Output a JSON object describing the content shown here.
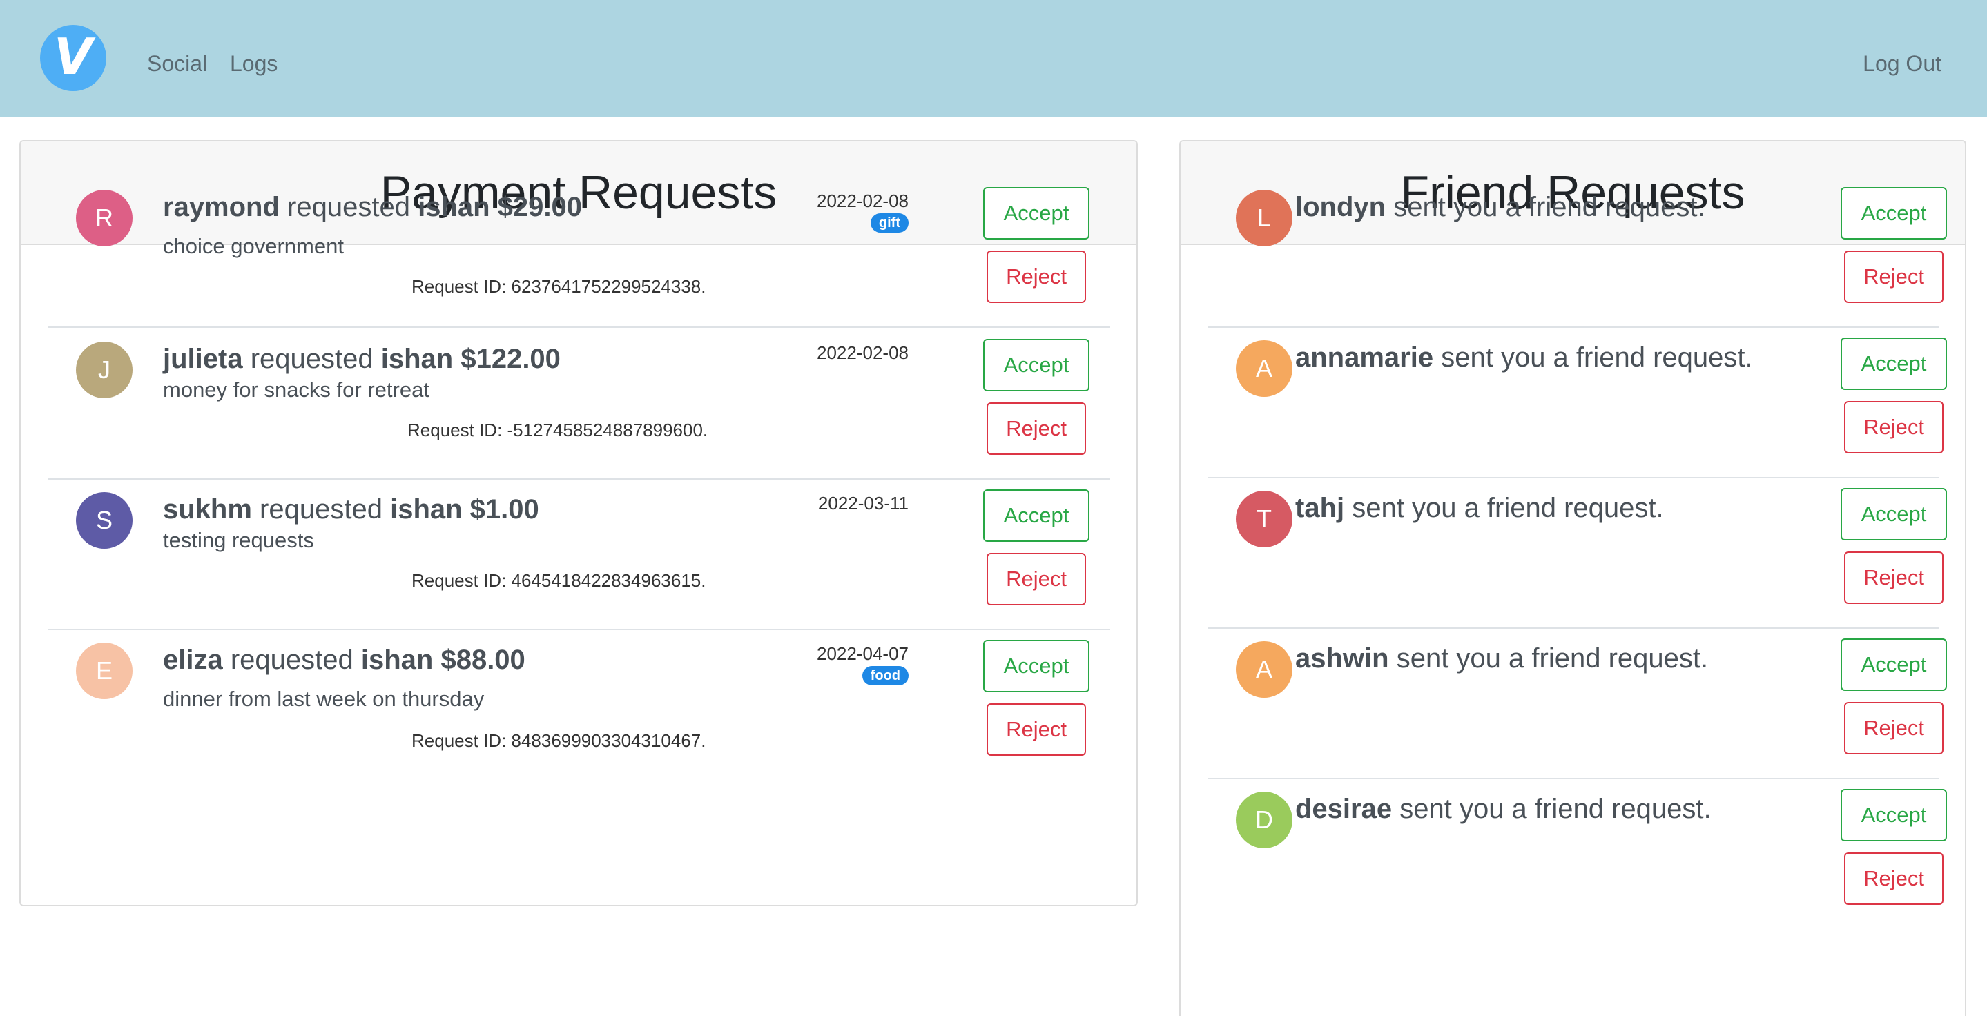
{
  "colors": {
    "navbar_bg": "#add5e1",
    "logo_bg": "#4eaef5",
    "accept": "#28a745",
    "reject": "#dc3545",
    "tag_bg": "#1e88e5"
  },
  "nav": {
    "logo_letter": "V",
    "links": [
      "Social",
      "Logs"
    ],
    "logout": "Log Out"
  },
  "payments": {
    "title": "Payment Requests",
    "items": [
      {
        "initial": "R",
        "avatar_color": "#dd5f86",
        "from": "raymond",
        "verb": " requested ",
        "to": "ishan",
        "amount": " $29.00",
        "memo": "choice government",
        "request_id": "Request ID: 6237641752299524338.",
        "date": "2022-02-08",
        "tag": "gift",
        "accept": "Accept",
        "reject": "Reject"
      },
      {
        "initial": "J",
        "avatar_color": "#b9a87c",
        "from": "julieta",
        "verb": " requested ",
        "to": "ishan",
        "amount": " $122.00",
        "memo": "money for snacks for retreat",
        "request_id": "Request ID: -5127458524887899600.",
        "date": "2022-02-08",
        "tag": "",
        "accept": "Accept",
        "reject": "Reject"
      },
      {
        "initial": "S",
        "avatar_color": "#5e5ba6",
        "from": "sukhm",
        "verb": " requested ",
        "to": "ishan",
        "amount": " $1.00",
        "memo": "testing requests",
        "request_id": "Request ID: 4645418422834963615.",
        "date": "2022-03-11",
        "tag": "",
        "accept": "Accept",
        "reject": "Reject"
      },
      {
        "initial": "E",
        "avatar_color": "#f7c2a5",
        "from": "eliza",
        "verb": " requested ",
        "to": "ishan",
        "amount": " $88.00",
        "memo": "dinner from last week on thursday",
        "request_id": "Request ID: 8483699903304310467.",
        "date": "2022-04-07",
        "tag": "food",
        "accept": "Accept",
        "reject": "Reject"
      }
    ]
  },
  "friends": {
    "title": "Friend Requests",
    "suffix": " sent you a friend request.",
    "items": [
      {
        "initial": "L",
        "avatar_color": "#e07358",
        "name": "londyn",
        "accept": "Accept",
        "reject": "Reject"
      },
      {
        "initial": "A",
        "avatar_color": "#f5a85e",
        "name": "annamarie",
        "accept": "Accept",
        "reject": "Reject"
      },
      {
        "initial": "T",
        "avatar_color": "#d65a63",
        "name": "tahj",
        "accept": "Accept",
        "reject": "Reject"
      },
      {
        "initial": "A",
        "avatar_color": "#f5a85e",
        "name": "ashwin",
        "accept": "Accept",
        "reject": "Reject"
      },
      {
        "initial": "D",
        "avatar_color": "#9acb5c",
        "name": "desirae",
        "accept": "Accept",
        "reject": "Reject"
      }
    ]
  }
}
